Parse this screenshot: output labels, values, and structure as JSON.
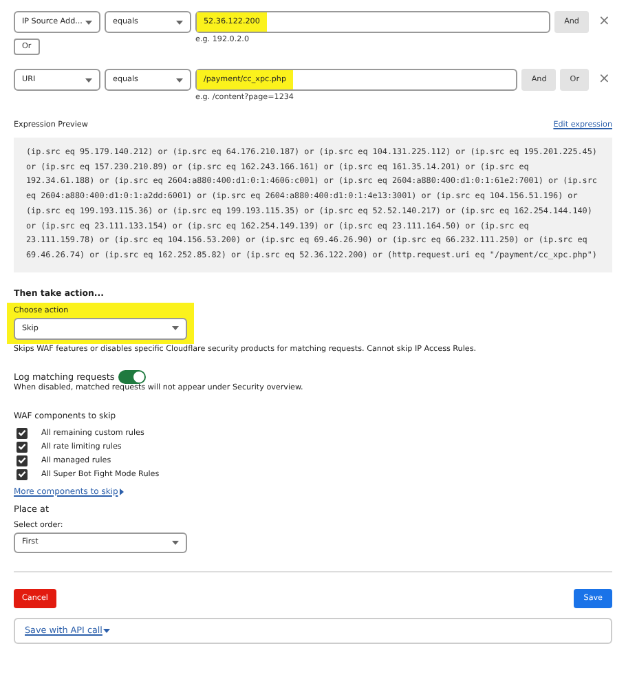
{
  "conditions": [
    {
      "field": "IP Source Add...",
      "operator": "equals",
      "value": "52.36.122.200",
      "highlighted": true,
      "hint": "e.g. 192.0.2.0",
      "buttons": [
        "And"
      ],
      "below_button": "Or"
    },
    {
      "field": "URI",
      "operator": "equals",
      "value": "/payment/cc_xpc.php",
      "highlighted": true,
      "hint": "e.g. /content?page=1234",
      "buttons": [
        "And",
        "Or"
      ]
    }
  ],
  "close_icon": "×",
  "expression_preview": {
    "label": "Expression Preview",
    "edit_link": "Edit expression",
    "code": "(ip.src eq 95.179.140.212) or (ip.src eq 64.176.210.187) or (ip.src eq 104.131.225.112) or (ip.src eq 195.201.225.45) or (ip.src eq 157.230.210.89) or (ip.src eq 162.243.166.161) or (ip.src eq 161.35.14.201) or (ip.src eq 192.34.61.188) or (ip.src eq 2604:a880:400:d1:0:1:4606:c001) or (ip.src eq 2604:a880:400:d1:0:1:61e2:7001) or (ip.src eq 2604:a880:400:d1:0:1:a2dd:6001) or (ip.src eq 2604:a880:400:d1:0:1:4e13:3001) or (ip.src eq 104.156.51.196) or (ip.src eq 199.193.115.36) or (ip.src eq 199.193.115.35) or (ip.src eq 52.52.140.217) or (ip.src eq 162.254.144.140) or (ip.src eq 23.111.133.154) or (ip.src eq 162.254.149.139) or (ip.src eq 23.111.164.50) or (ip.src eq 23.111.159.78) or (ip.src eq 104.156.53.200) or (ip.src eq 69.46.26.90) or (ip.src eq 66.232.111.250) or (ip.src eq 69.46.26.74) or (ip.src eq 162.252.85.82) or (ip.src eq 52.36.122.200) or (http.request.uri eq \"/payment/cc_xpc.php\")"
  },
  "action": {
    "heading": "Then take action...",
    "label": "Choose action",
    "value": "Skip",
    "highlighted": true,
    "description": "Skips WAF features or disables specific Cloudflare security products for matching requests. Cannot skip IP Access Rules."
  },
  "log": {
    "label": "Log matching requests",
    "on": true,
    "description": "When disabled, matched requests will not appear under Security overview."
  },
  "waf": {
    "label": "WAF components to skip",
    "items": [
      {
        "label": "All remaining custom rules",
        "checked": true
      },
      {
        "label": "All rate limiting rules",
        "checked": true
      },
      {
        "label": "All managed rules",
        "checked": true
      },
      {
        "label": "All Super Bot Fight Mode Rules",
        "checked": true
      }
    ],
    "more_link": "More components to skip"
  },
  "place": {
    "heading": "Place at",
    "label": "Select order:",
    "value": "First"
  },
  "footer": {
    "cancel": "Cancel",
    "save": "Save",
    "api_link": "Save with API call"
  }
}
